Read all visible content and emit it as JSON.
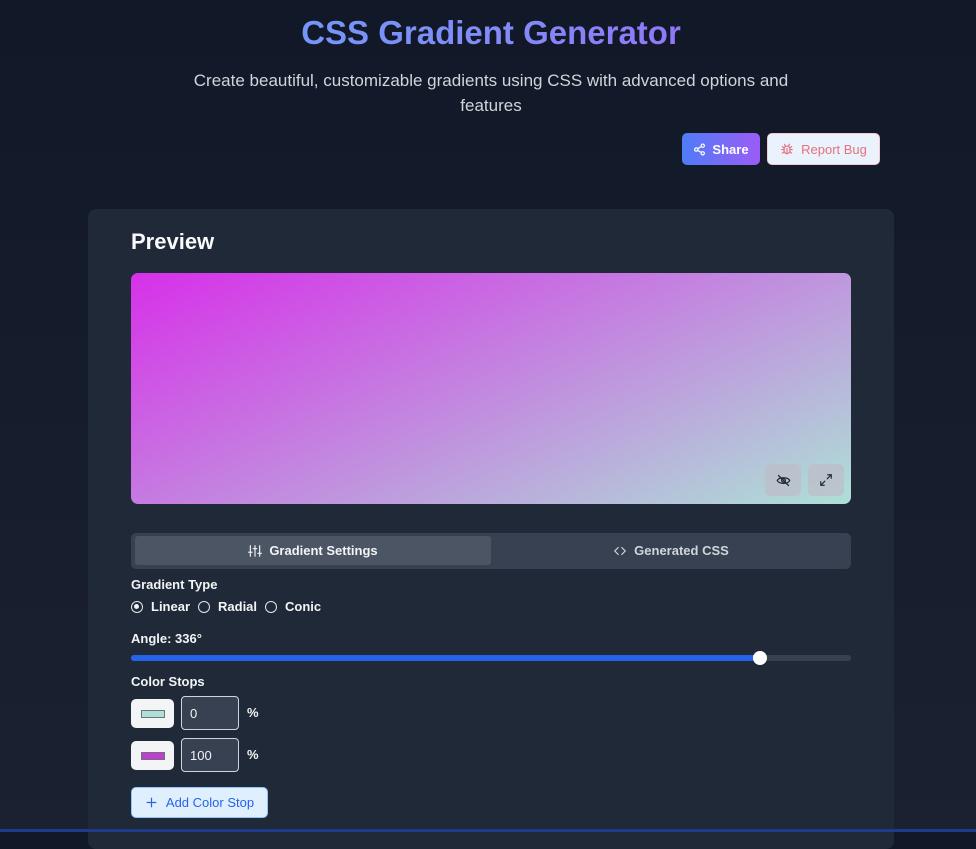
{
  "header": {
    "title": "CSS Gradient Generator",
    "subtitle": "Create beautiful, customizable gradients using CSS with advanced options and features",
    "share_label": "Share",
    "report_bug_label": "Report Bug"
  },
  "preview": {
    "title": "Preview",
    "gradient": {
      "type": "linear",
      "angle_deg": 336,
      "start_color": "#d730e9",
      "end_color": "#aee0d6"
    },
    "toggle_visibility_icon": "eye-off-icon",
    "fullscreen_icon": "expand-icon"
  },
  "tabs": [
    {
      "label": "Gradient Settings",
      "icon": "sliders-icon",
      "active": true
    },
    {
      "label": "Generated CSS",
      "icon": "code-icon",
      "active": false
    }
  ],
  "settings": {
    "gradient_type_label": "Gradient Type",
    "gradient_types": [
      {
        "label": "Linear",
        "checked": true
      },
      {
        "label": "Radial",
        "checked": false
      },
      {
        "label": "Conic",
        "checked": false
      }
    ],
    "angle_label": "Angle: 336°",
    "angle": {
      "value": 336,
      "min": 0,
      "max": 360
    },
    "color_stops_label": "Color Stops",
    "color_stops": [
      {
        "color": "#aee0d6",
        "position": "0",
        "unit": "%"
      },
      {
        "color": "#c03fd0",
        "position": "100",
        "unit": "%"
      }
    ],
    "add_stop_label": "Add Color Stop"
  },
  "colors": {
    "accent": "#2563eb",
    "share_gradient_start": "#4f7cf7",
    "share_gradient_end": "#9b5cf6",
    "bug_text": "#e8707f"
  }
}
